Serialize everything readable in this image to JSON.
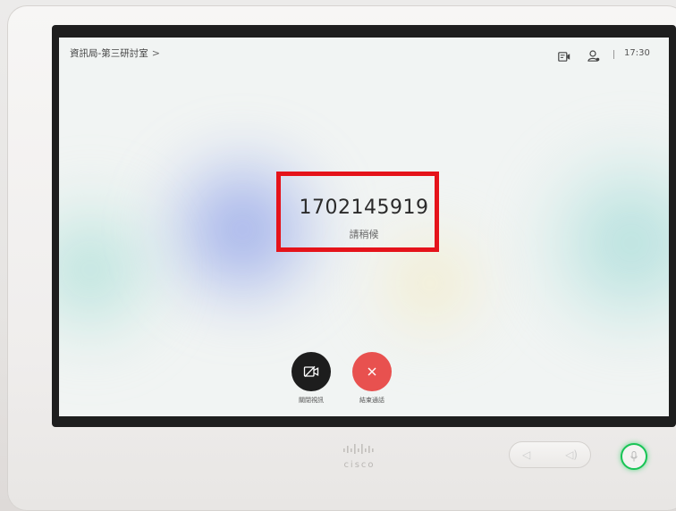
{
  "header": {
    "room_name": "資訊局-第三研討室",
    "chevron": ">",
    "time": "17:30",
    "icons": [
      "video-icon",
      "user-icon"
    ]
  },
  "call": {
    "number": "1702145919",
    "status": "請稍候",
    "highlight_color": "#e5131a"
  },
  "controls": {
    "turn_off_video_label": "關閉視訊",
    "end_call_label": "結束通話",
    "end_call_color": "#e8514f"
  },
  "device": {
    "brand": "cisco",
    "mute_indicator_color": "#19c456"
  }
}
